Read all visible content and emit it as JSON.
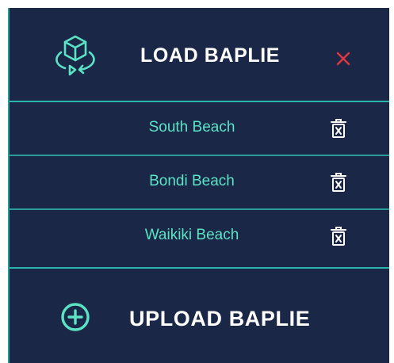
{
  "header": {
    "title": "LOAD BAPLIE",
    "icon": "cube-rotate-icon",
    "close_icon": "close-icon"
  },
  "files": [
    {
      "name": "South Beach",
      "delete_icon": "trash-icon"
    },
    {
      "name": "Bondi Beach",
      "delete_icon": "trash-icon"
    },
    {
      "name": "Waikiki Beach",
      "delete_icon": "trash-icon"
    }
  ],
  "upload": {
    "label": "UPLOAD BAPLIE",
    "icon": "plus-circle-icon"
  },
  "colors": {
    "background": "#1b2746",
    "accent": "#2bb3ad",
    "item_text": "#5be3c6",
    "title_text": "#ffffff",
    "close": "#e0383e"
  }
}
